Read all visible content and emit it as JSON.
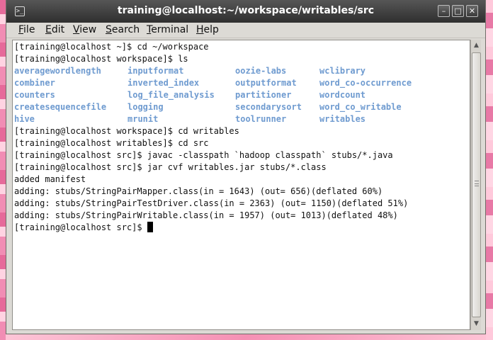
{
  "window": {
    "title": "training@localhost:~/workspace/writables/src",
    "controls": {
      "minimize": "–",
      "maximize": "□",
      "close": "✕"
    }
  },
  "menu": {
    "items": [
      {
        "ul": "F",
        "rest": "ile"
      },
      {
        "ul": "E",
        "rest": "dit"
      },
      {
        "ul": "V",
        "rest": "iew"
      },
      {
        "ul": "S",
        "rest": "earch"
      },
      {
        "ul": "T",
        "rest": "erminal"
      },
      {
        "ul": "H",
        "rest": "elp"
      }
    ]
  },
  "terminal": {
    "lines_before": [
      "[training@localhost ~]$ cd ~/workspace",
      "[training@localhost workspace]$ ls"
    ],
    "ls_rows": [
      [
        "averagewordlength",
        "inputformat",
        "oozie-labs",
        "wclibrary"
      ],
      [
        "combiner",
        "inverted_index",
        "outputformat",
        "word_co-occurrence"
      ],
      [
        "counters",
        "log_file_analysis",
        "partitioner",
        "wordcount"
      ],
      [
        "createsequencefile",
        "logging",
        "secondarysort",
        "word_co_writable"
      ],
      [
        "hive",
        "mrunit",
        "toolrunner",
        "writables"
      ]
    ],
    "lines_after": [
      "[training@localhost workspace]$ cd writables",
      "[training@localhost writables]$ cd src",
      "[training@localhost src]$ javac -classpath `hadoop classpath` stubs/*.java",
      "[training@localhost src]$ jar cvf writables.jar stubs/*.class",
      "added manifest",
      "adding: stubs/StringPairMapper.class(in = 1643) (out= 656)(deflated 60%)",
      "adding: stubs/StringPairTestDriver.class(in = 2363) (out= 1150)(deflated 51%)",
      "adding: stubs/StringPairWritable.class(in = 1957) (out= 1013)(deflated 48%)"
    ],
    "prompt": "[training@localhost src]$ ",
    "colors": {
      "directory": "#6f9bd0",
      "text": "#111111",
      "background": "#ffffff"
    }
  }
}
